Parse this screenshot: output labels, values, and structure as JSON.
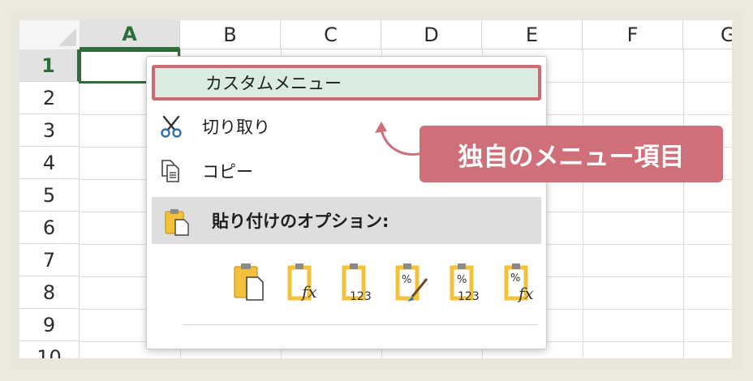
{
  "spreadsheet": {
    "columns": [
      "A",
      "B",
      "C",
      "D",
      "E",
      "F",
      "G"
    ],
    "rows": [
      "1",
      "2",
      "3",
      "4",
      "5",
      "6",
      "7",
      "8",
      "9",
      "10"
    ],
    "active_column": "A",
    "active_row": "1",
    "active_color": "#2e6e3a"
  },
  "context_menu": {
    "custom_item": "カスタムメニュー",
    "cut": "切り取り",
    "copy": "コピー",
    "paste_options_header": "貼り付けのオプション:",
    "paste_options": [
      {
        "name": "paste",
        "sub": ""
      },
      {
        "name": "paste-formulas",
        "sub": "fx"
      },
      {
        "name": "paste-values",
        "sub": "123"
      },
      {
        "name": "paste-formatting",
        "sub": "%"
      },
      {
        "name": "paste-values-number-formatting",
        "sub": "123"
      },
      {
        "name": "paste-formulas-number-formatting",
        "sub": "fx"
      }
    ]
  },
  "callout": {
    "text": "独自のメニュー項目",
    "color": "#cf6f79"
  }
}
